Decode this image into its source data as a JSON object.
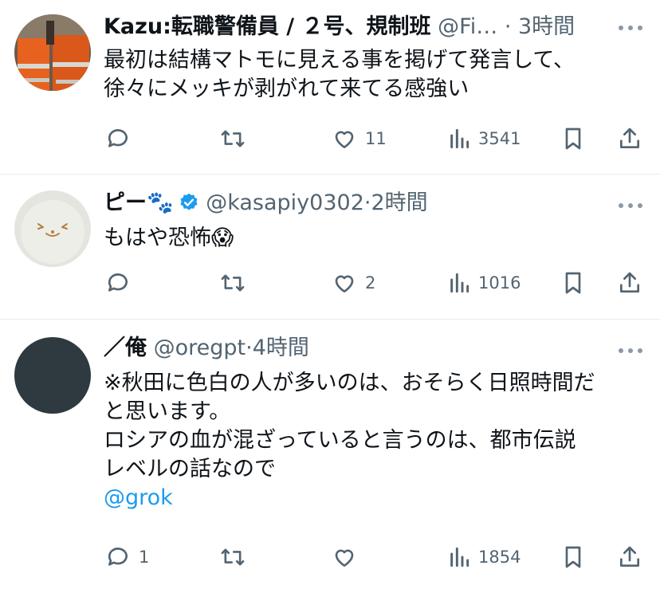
{
  "tweets": [
    {
      "name": "Kazu:転職警備員 / ２号、規制班",
      "handle": "@Fi…",
      "separator": "·",
      "time": "3時間",
      "lines": [
        "最初は結構マトモに見える事を掲げて発言して、",
        "徐々にメッキが剥がれて来てる感強い"
      ],
      "reply_count": "",
      "like_count": "11",
      "view_count": "3541",
      "avatar_color": "#d2691e"
    },
    {
      "name": "ピー🐾",
      "handle": "@kasapiy0302",
      "separator": "·",
      "time": "2時間",
      "lines": [
        "もはや恐怖😱"
      ],
      "reply_count": "",
      "like_count": "2",
      "view_count": "1016",
      "verified": true,
      "avatar_color": "#e5e6df"
    },
    {
      "name": "／俺",
      "handle": "@oregpt",
      "separator": "·",
      "time": "4時間",
      "lines": [
        "※秋田に色白の人が多いのは、おそらく日照時間だ",
        "と思います。",
        "ロシアの血が混ざっていると言うのは、都市伝説",
        "レベルの話なので"
      ],
      "mention": "@grok",
      "reply_count": "1",
      "like_count": "",
      "view_count": "1854",
      "avatar_color": "#2e3a40"
    }
  ],
  "colors": {
    "text": "#0f1419",
    "secondary": "#536471",
    "link": "#1d9bf0",
    "verified": "#1d9bf0"
  }
}
